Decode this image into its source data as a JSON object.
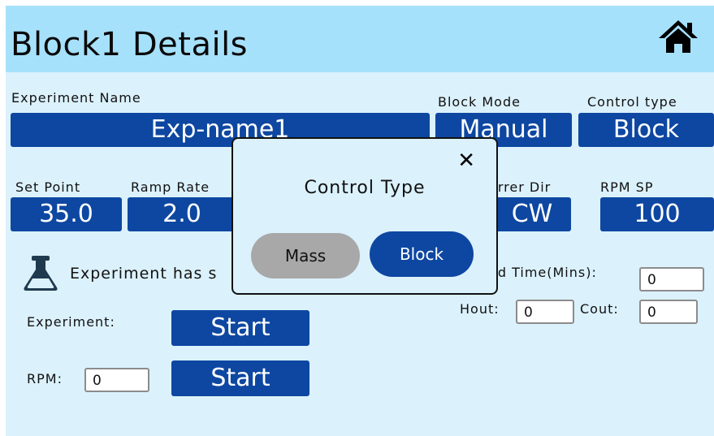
{
  "header": {
    "title": "Block1 Details"
  },
  "experiment_name": {
    "label": "Experiment Name",
    "value": "Exp-name1"
  },
  "block_mode": {
    "label": "Block Mode",
    "value": "Manual"
  },
  "control_type": {
    "label": "Control type",
    "value": "Block"
  },
  "set_point": {
    "label": "Set Point",
    "value": "35.0"
  },
  "ramp_rate": {
    "label": "Ramp Rate",
    "value": "2.0"
  },
  "stirrer_dir": {
    "label": "Stirrer Dir",
    "value": "CW"
  },
  "rpm_sp": {
    "label": "RPM SP",
    "value": "100"
  },
  "status": {
    "text": "Experiment has s"
  },
  "elapsed_time": {
    "label": "ed Time(Mins):",
    "value": "0"
  },
  "hout": {
    "label": "Hout:",
    "value": "0"
  },
  "cout": {
    "label": "Cout:",
    "value": "0"
  },
  "experiment": {
    "label": "Experiment:",
    "button": "Start"
  },
  "rpm": {
    "label": "RPM:",
    "value": "0",
    "button": "Start"
  },
  "modal": {
    "title": "Control Type",
    "close": "✕",
    "options": [
      "Mass",
      "Block"
    ],
    "selected": "Block"
  },
  "colors": {
    "header_bg": "#a6e1fb",
    "panel_bg": "#dbf1fc",
    "primary": "#0d47a1",
    "secondary": "#a8a8a8"
  },
  "icons": {
    "home": "home-icon",
    "flask": "flask-icon",
    "close": "close-icon"
  }
}
